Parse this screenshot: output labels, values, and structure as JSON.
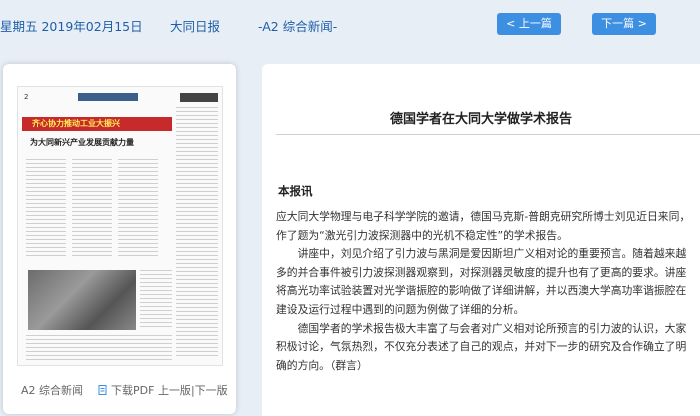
{
  "topbar": {
    "date": "星期五 2019年02月15日",
    "paper": "大同日报",
    "section": "-A2 综合新闻-",
    "prev_label": "< 上一篇",
    "next_label": "下一篇 >"
  },
  "left_panel": {
    "section_label": "A2 综合新闻",
    "pdf_label": "下载PDF",
    "prev_page_label": "上一版",
    "separator": "|",
    "next_page_label": "下一版",
    "thumbnail": {
      "page_no": "2",
      "headline": "齐心协力推动工业大振兴",
      "subheadline": "为大同新兴产业发展贡献力量"
    }
  },
  "article": {
    "title": "德国学者在大同大学做学术报告",
    "byline": "本报讯",
    "paragraphs": [
      "应大同大学物理与电子科学学院的邀请，德国马克斯-普朗克研究所博士刘见近日来同，作了题为“激光引力波探测器中的光机不稳定性”的学术报告。",
      "讲座中，刘见介绍了引力波与黑洞是爱因斯坦广义相对论的重要预言。随着越来越多的并合事件被引力波探测器观察到，对探测器灵敏度的提升也有了更高的要求。讲座将高光功率试验装置对光学谐振腔的影响做了详细讲解，并以西澳大学高功率谐振腔在建设及运行过程中遇到的问题为例做了详细的分析。",
      "德国学者的学术报告极大丰富了与会者对广义相对论所预言的引力波的认识，大家积极讨论，气氛热烈，不仅充分表述了自己的观点，并对下一步的研究及合作确立了明确的方向。（群言）"
    ]
  },
  "colors": {
    "accent": "#3d8fe2",
    "link_text": "#1e5fa8",
    "background": "#e8eef6"
  }
}
